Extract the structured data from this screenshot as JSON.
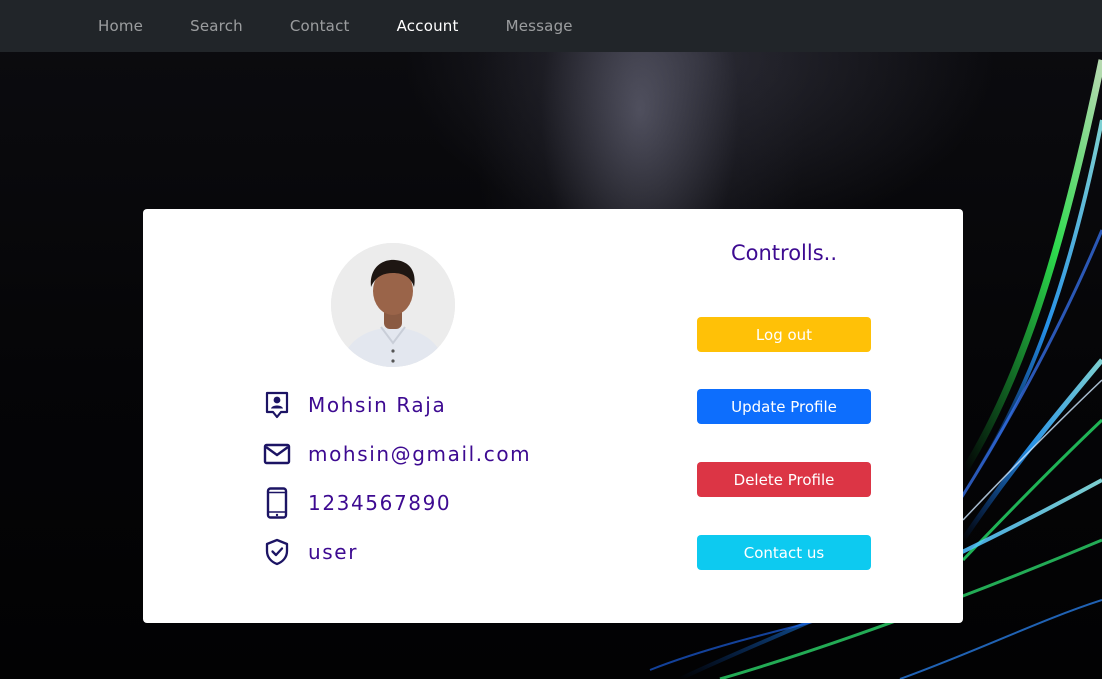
{
  "nav": {
    "items": [
      {
        "label": "Home",
        "active": false
      },
      {
        "label": "Search",
        "active": false
      },
      {
        "label": "Contact",
        "active": false
      },
      {
        "label": "Account",
        "active": true
      },
      {
        "label": "Message",
        "active": false
      }
    ]
  },
  "profile": {
    "name": "Mohsin Raja",
    "email": "mohsin@gmail.com",
    "phone": "1234567890",
    "role": "user",
    "icons": [
      "person-badge-icon",
      "envelope-icon",
      "phone-icon",
      "shield-check-icon"
    ]
  },
  "controls": {
    "title": "Controlls..",
    "logout_label": "Log out",
    "update_label": "Update Profile",
    "delete_label": "Delete Profile",
    "contact_label": "Contact us"
  },
  "colors": {
    "navbar": "#212529",
    "text_accent": "#3d0a91",
    "icon": "#1c1464",
    "logout": "#ffc107",
    "update": "#0d6efd",
    "delete": "#dc3545",
    "contact": "#0dcaf0"
  }
}
